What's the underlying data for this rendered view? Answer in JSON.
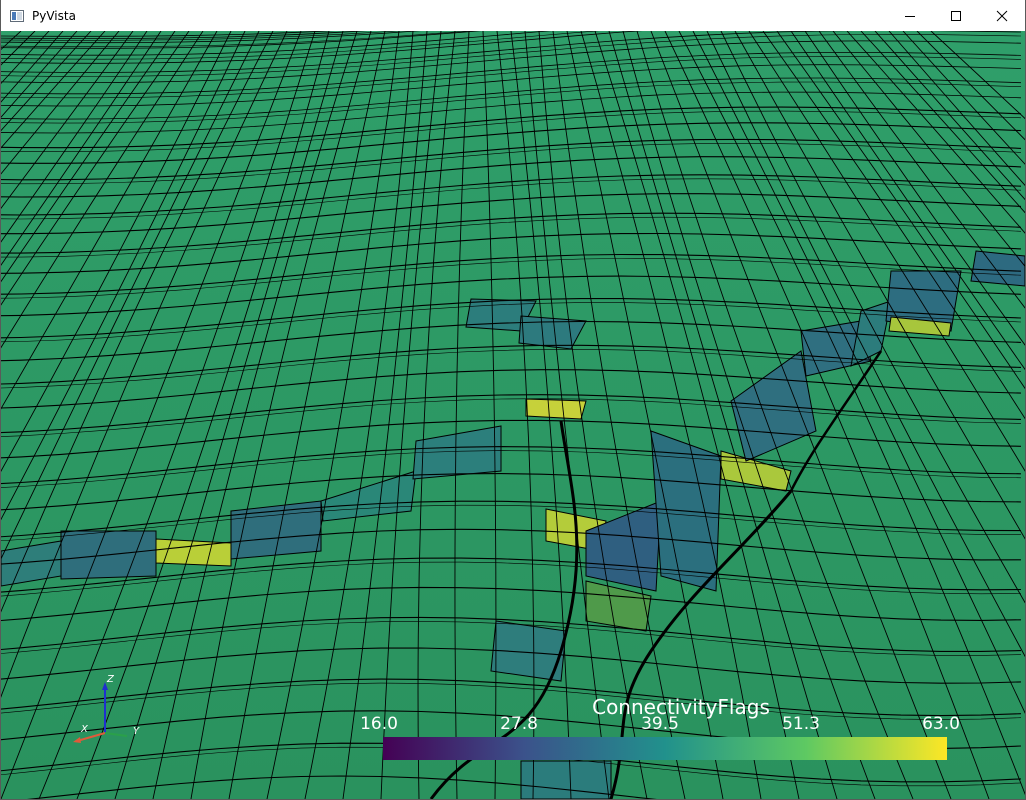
{
  "window": {
    "title": "PyVista"
  },
  "colorbar": {
    "title": "ConnectivityFlags",
    "ticks": [
      "16.0",
      "27.8",
      "39.5",
      "51.3",
      "63.0"
    ],
    "colormap": "viridis",
    "colors": [
      "#440154",
      "#3b528b",
      "#21918c",
      "#5ec962",
      "#fde725"
    ]
  },
  "axes": {
    "x": "X",
    "y": "Y",
    "z": "Z"
  },
  "scene": {
    "mesh_color": "#2c9a62",
    "edge_color": "#000000"
  }
}
